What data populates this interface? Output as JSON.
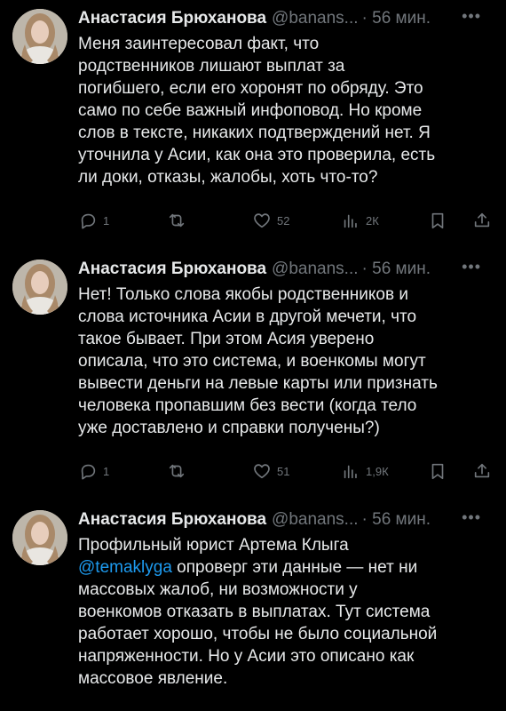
{
  "tweets": [
    {
      "author": "Анастасия Брюханова",
      "handle": "@banans...",
      "time": "· 56 мин.",
      "text": "Меня заинтересовал факт, что\nродственников лишают выплат за\nпогибшего, если его хоронят по обряду. Это\nсамо по себе важный инфоповод. Но кроме\nслов в тексте, никаких подтверждений нет. Я\nуточнила у Асии, как она это проверила, есть\nли доки, отказы, жалобы, хоть что-то?",
      "replies": "1",
      "retweets": "",
      "likes": "52",
      "views": "2К"
    },
    {
      "author": "Анастасия Брюханова",
      "handle": "@banans...",
      "time": "· 56 мин.",
      "text": "Нет! Только слова якобы родственников и\nслова источника Асии в другой мечети, что\nтакое бывает. При этом Асия уверено\nописала, что это система, и военкомы могут\nвывести деньги на левые карты или признать\nчеловека пропавшим без вести (когда тело\nуже доставлено и справки получены?)",
      "replies": "1",
      "retweets": "",
      "likes": "51",
      "views": "1,9К"
    },
    {
      "author": "Анастасия Брюханова",
      "handle": "@banans...",
      "time": "· 56 мин.",
      "text_before": "Профильный юрист Артема Клыга\n",
      "mention": "@temaklyga",
      "text_after": " опроверг эти данные — нет ни\nмассовых жалоб, ни возможности у\nвоенкомов отказать в выплатах. Тут система\nработает хорошо, чтобы не было социальной\nнапряженности. Но у Асии это описано как\nмассовое явление."
    }
  ],
  "icons": {
    "more": "more-horizontal-icon",
    "reply": "reply-icon",
    "retweet": "retweet-icon",
    "like": "heart-icon",
    "views": "views-icon",
    "bookmark": "bookmark-icon",
    "share": "share-icon"
  },
  "colors": {
    "background": "#000000",
    "text": "#e7e9ea",
    "muted": "#71767b",
    "link": "#1d9bf0"
  }
}
